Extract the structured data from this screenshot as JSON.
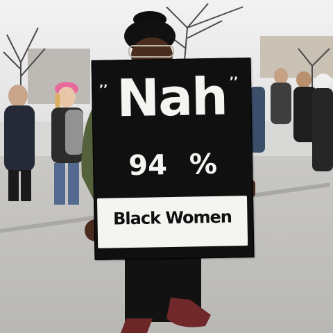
{
  "sign": {
    "headline": "Nah",
    "statistic": "94 %",
    "subject": "Black Women"
  },
  "colors": {
    "sign_background": "#101010",
    "sign_lettering": "#f4f4f0",
    "pink_hat": "#e86a9c"
  }
}
